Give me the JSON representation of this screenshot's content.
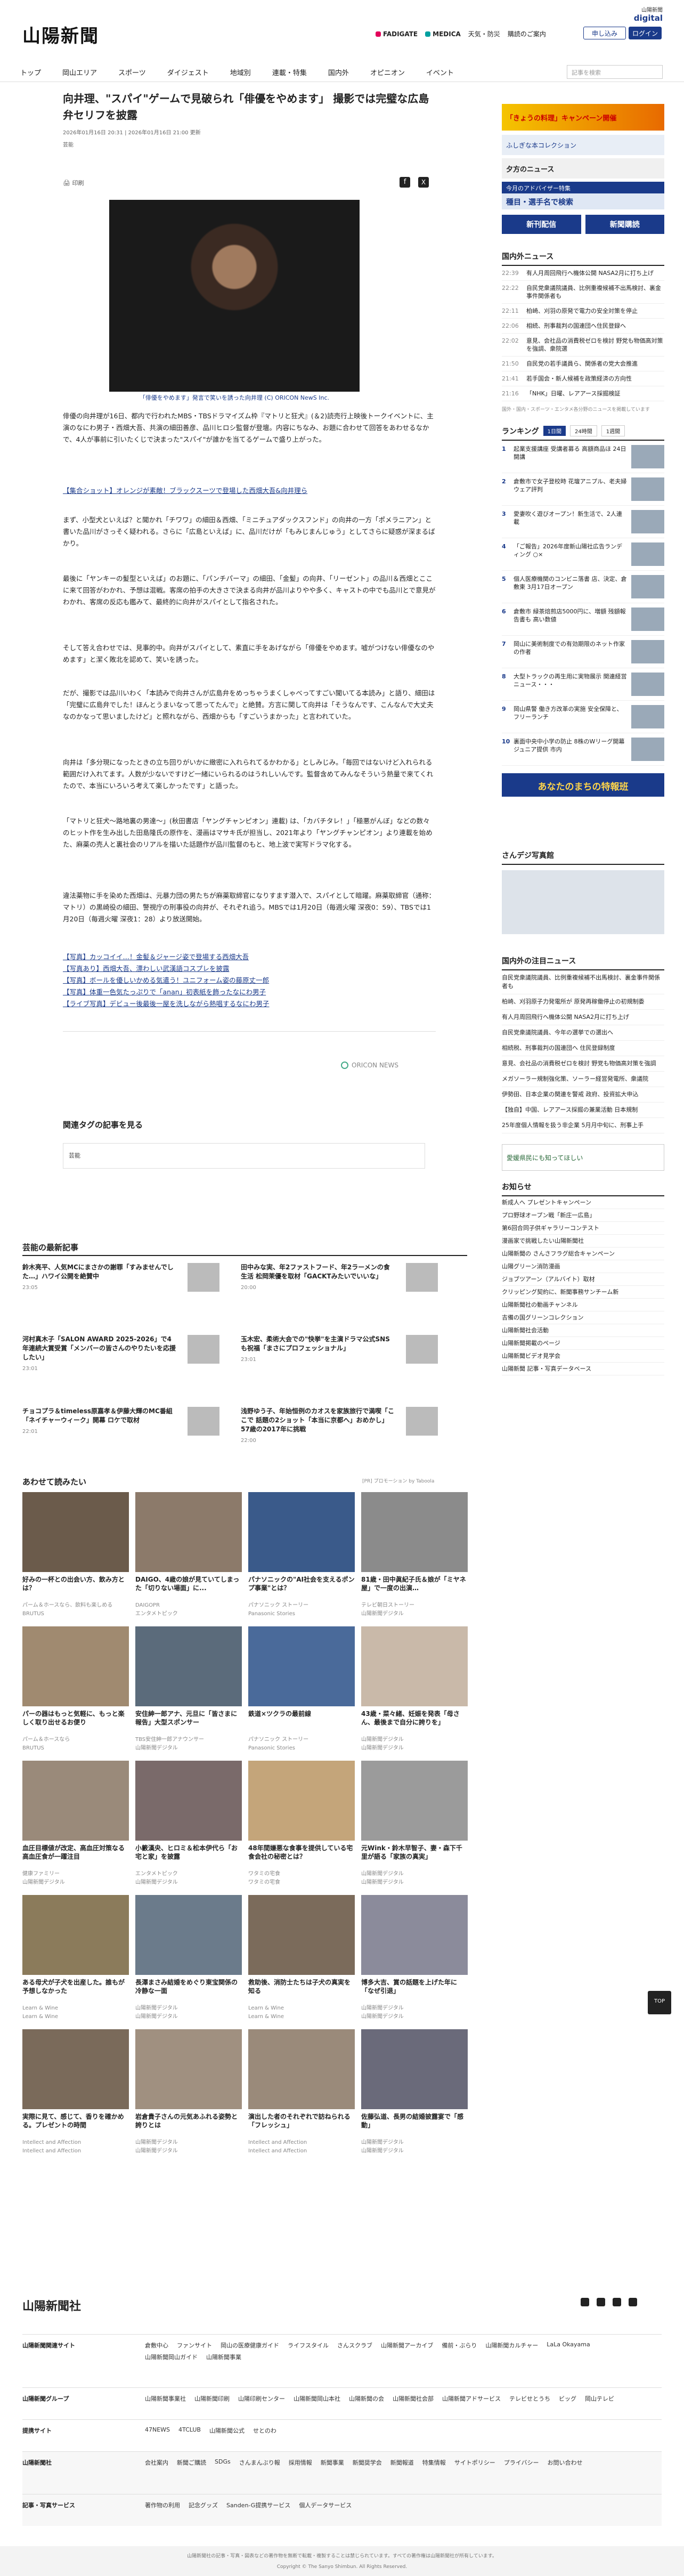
{
  "header": {
    "logo": "山陽新聞",
    "digital_small": "山陽新聞",
    "digital": "digital",
    "links": [
      "FADIGATE",
      "MEDICA",
      "天気・防災",
      "購読のご案内"
    ],
    "login": "ログイン",
    "signup": "申し込み",
    "nav": [
      "トップ",
      "岡山エリア",
      "スポーツ",
      "ダイジェスト",
      "地域別",
      "連載・特集",
      "国内外",
      "オピニオン",
      "イベント"
    ],
    "search_placeholder": "記事を検索"
  },
  "article": {
    "title": "向井理、\"スパイ\"ゲームで見破られ「俳優をやめます」 撮影では完璧な広島弁セリフを披露",
    "date": "2026年01月16日 20:31 | 2026年01月16日 21:00 更新",
    "source": "芸能",
    "print": "印刷",
    "caption": "「俳優をやめます」発言で笑いを誘った向井理 (C) ORICON NewS Inc.",
    "paragraphs": [
      "俳優の向井理が16日、都内で行われたMBS・TBSドラマイズム枠『マトリと狂犬』(＆2)読売行上映後トークイベントに、主演のなにわ男子・西畑大吾、共演の細田善彦、品川ヒロシ監督が登壇。内容にちなみ、お題に合わせて回答をあわせるなかで、4人が事前に引いたくじで決まった\"スパイ\"が誰かを当てるゲームで盛り上がった。",
      "【集合ショット】オレンジが素敵！ブラックスーツで登場した西畑大吾&向井理ら",
      "まず、小型犬といえば？と聞かれ「チワワ」の細田＆西畑、「ミニチュアダックスフンド」の向井の一方「ポメラニアン」と書いた品川がさっそく疑われる。さらに「広島といえば」に、品川だけが「もみじまんじゅう」としてさらに疑惑が深まるばかり。",
      "最後に「ヤンキーの髪型といえば」のお題に、「パンチパーマ」の細田、「金髪」の向井、「リーゼント」の品川＆西畑とここに来て回答がわかれ、予想は混戦。客席の拍手の大きさで決まる向井が品川よりやや多く、キャストの中でも品川とで意見がわかれ、客席の反応も鑑みて、最終的に向井がスパイとして指名された。",
      "そして答え合わせでは、見事的中。向井がスパイとして、素直に手をあげながら「俳優をやめます。嘘がつけない俳優なのやめます」と潔く敗北を認めて、笑いを誘った。",
      "だが、撮影では品川いわく「本読みで向井さんが広島弁をめっちゃうまくしゃべってすごい聞いてる本読み」と語り、細田は「完璧に広島弁でした！ほんとうまいなって思ってたんで」と絶賛。方言に関して向井は「そうなんです、こんなんで大丈夫なのかなって思いましたけど」と照れながら、西畑からも「すごいうまかった」と言われていた。",
      "向井は「多分現になったときの立ち回りがいかに緻密に入れられてるかわかる」としみじみ。「毎回ではないけど入れられる範囲だけ入れてます。人数が少ないですけど一緒にいられるのはうれしいんです。監督含めてみんなそういう熱量で来てくれたので、本当にいろいろ考えて楽しかったです」と語った。",
      "「マトリと狂犬〜路地裏の男達〜」(秋田書店「ヤングチャンピオン」連載) は、「カバチタレ！」「極悪がんぼ」などの数々のヒット作を生み出した田島隆氏の原作を、漫画はマサキ氏が担当し、2021年より「ヤングチャンピオン」より連載を始めた、麻薬の売人と裏社会のリアルを描いた話題作が品川監督のもと、地上波で実写ドラマ化する。",
      "違法薬物に手を染めた西畑は、元暴力団の男たちが麻薬取締官になりすます潜入で、スパイとして暗躍。麻薬取締官（通称：マトリ）の黒崎役の細田、警視庁の刑事役の向井が、それぞれ追う。MBSでは1月20日（毎週火曜 深夜0：59）、TBSでは1月20日（毎週火曜 深夜1：28）より放送開始。"
    ],
    "related_links": [
      "【写真】カッコイイ…！金髪＆ジャージ姿で登場する西畑大吾",
      "【写真あり】西畑大吾、漂わしい武漢語コスプレを披露",
      "【写真】ボールを優しいかめる気遣う！ユニフォーム姿の藤原丈一郎",
      "【写真】体重一色気たっぷりで「anan」初表紙を飾ったなにわ男子",
      "【ライブ写真】デビュー後最後一屋を洗しながら熱唱するなにわ男子"
    ],
    "oricon": "ORICON NEWS",
    "tags_heading": "関連タグの記事を見る",
    "tag": "芸能"
  },
  "sidebar": {
    "ad1": "「きょうの料理」キャンペーン開催",
    "ad2": "ふしぎな本コレクション",
    "ad3": "夕方のニュース",
    "ad4": "今月のアドバイザー特集",
    "ad5": "種目・選手名で検索",
    "btn1": "新刊配信",
    "btn2": "新聞購読",
    "domestic_heading": "国内外ニュース",
    "domestic": [
      {
        "t": "22:39",
        "s": "有人月周回飛行へ機体公開 NASA2月に打ち上げ"
      },
      {
        "t": "22:22",
        "s": "自民党衆議院議員、比例重複候補不出馬検討、裏金事件関係者も"
      },
      {
        "t": "22:11",
        "s": "柏崎、刈羽の原発で電力の安全対策を停止"
      },
      {
        "t": "22:06",
        "s": "相続、刑事裁判の国連団へ住民登録へ"
      },
      {
        "t": "22:02",
        "s": "意見、会社品の消費税ゼロを検討 野党も物価高対策を強調、衆院選"
      },
      {
        "t": "21:50",
        "s": "自民党の若手議員ら、関係者の党大会推進"
      },
      {
        "t": "21:41",
        "s": "若手国会・新人候補を政策経済の方向性"
      },
      {
        "t": "21:16",
        "s": "「NHK」日曜、レアアース採掘検証"
      }
    ],
    "domestic_note": "国外・国内・スポーツ・エンタメ各分野のニュースを掲載しています",
    "ranking_heading": "ランキング",
    "ranking_tabs": [
      "1日間",
      "24時間",
      "1週間"
    ],
    "ranking": [
      "起業支援講座 受講者募る 高額商品ほ 24日開講",
      "倉敷市で女子登校時 花壇アニプル、老夫婦ウェア評判",
      "愛妻吹く遊びオープン！新生活で、2人連載",
      "「ご報告」2026年度新山陽社広告ランディング ○×",
      "個人医療機関のコンビニ落書 店、決定、倉敷東 3月17日オープン",
      "倉敷市 緑茶焙煎店5000円に、増額 残額報告書も 高い数値",
      "岡山に美術制度での有効期限のネット作家の作者",
      "大型トラックの再生用に実物展示 関連経営ニュース・・・",
      "岡山県警 働き方改革の実施 安全保障と、フリーランチ",
      "裏面中央中小学の防止 8株のWリーグ開幕ジュニア提供 市内"
    ],
    "banner": "あなたのまちの特報班",
    "sanyo_heading": "さんデジ写真館",
    "hot_heading": "国内外の注目ニュース",
    "hot": [
      "自民党衆議院議員、比例重複候補不出馬検討、裏金事件関係者も",
      "柏崎、刈羽原子力発電所が 原発再稼働停止の初規制委",
      "有人月周回飛行へ機体公開 NASA2月に打ち上げ",
      "自民党衆議院議員、今年の選挙での選出へ",
      "相続税、刑事裁判の国連団へ 住民登録制度",
      "意見、会社品の消費税ゼロを検討 野党も物価高対策を強調",
      "メガソーラー規制強化策、ソーラー経営発電所、衆議院",
      "伊勢田、日本企業の関連を警戒 政府、投資拡大申込",
      "【独自】中国、レアアース採掘の兼業活動 日本規制",
      "25年度個人情報を扱う非企業 5月月中旬に、刑事上手"
    ],
    "ehime": "愛媛県民にも知ってほしい",
    "oshirase_heading": "お知らせ",
    "oshirase": [
      "新成人へ プレゼントキャンペーン",
      "プロ野球オープン戦「新庄一広島」",
      "第6回合同子供ギャラリーコンテスト",
      "漫画家で挑戦したい山陽新聞社",
      "山陽新聞の さんさフラグ総合キャンペーン",
      "山陽グリーン消防漫画",
      "ジョブツアーン（アルバイト）取材",
      "クリッピング契約に、新聞事務サンチーム新",
      "山陽新聞社の動画チャンネル",
      "吉備の国グリーンコレクション",
      "山陽新聞社会活動",
      "山陽新聞掲載のページ",
      "山陽新聞ビデオ見学会",
      "山陽新聞 記事・写真データベース"
    ]
  },
  "entertainment": {
    "heading": "芸能の最新記事",
    "items": [
      {
        "s": "鈴木亮平、人気MCにまさかの謝罪「すみませんでした…」ハワイ公開を絶賛中",
        "tm": "23:05"
      },
      {
        "s": "田中みな実、年2ファストフード、年2ラーメンの食生活 松岡茉優を取材「GACKTみたいでいいな」",
        "tm": "20:00"
      },
      {
        "s": "河村真木子「SALON AWARD 2025-2026」で4年連続大賞受賞「メンバーの皆さんのやりたいを応援したい」",
        "tm": "23:01"
      },
      {
        "s": "玉木宏、柔術大会での\"快挙\"を主演ドラマ公式SNSも祝福「まさにプロフェッショナル」",
        "tm": "23:01"
      },
      {
        "s": "チョコプラ＆timeless原嘉孝＆伊藤大輝のMC番組「ネイチャーウィーク」開幕 ロケで取材",
        "tm": "22:01"
      },
      {
        "s": "浅野ゆう子、年始恒例のカオスを家族旅行で満喫「ここで 話題の2ショット「本当に京都へ」おめかし」57歳の2017年に挑戦",
        "tm": "22:00"
      }
    ]
  },
  "recommend": {
    "heading": "あわせて読みたい",
    "pr": "[PR] プロモーション by Taboola",
    "cards": [
      {
        "t": "好みの一杯との出会い方、飲み方とは？",
        "s": "パーム＆ホースなら、飲料も楽しめる",
        "src": "BRUTUS"
      },
      {
        "t": "DAIGO、4歳の娘が見ていてしまった「切りない場面」に...",
        "s": "DAIGOPR",
        "src": "エンタメトピック"
      },
      {
        "t": "パナソニックの\"AI社会を支えるポンプ事業\"とは？",
        "s": "パナソニック ストーリー",
        "src": "Panasonic Stories"
      },
      {
        "t": "81歳・田中眞紀子氏＆娘が「ミヤネ屋」で一度の出演…",
        "s": "テレビ朝日ストーリー",
        "src": "山陽新聞デジタル"
      },
      {
        "t": "パーの器はもっと気軽に、もっと楽しく取り出せるお便り",
        "s": "パーム＆ホースなら",
        "src": "BRUTUS"
      },
      {
        "t": "安住紳一郎アナ、元旦に「皆さまに報告」大型スポンサー",
        "s": "TBS安住紳一郎アナウンサー",
        "src": "山陽新聞デジタル"
      },
      {
        "t": "鉄道×ツクラの最前線",
        "s": "パナソニック ストーリー",
        "src": "Panasonic Stories"
      },
      {
        "t": "43歳・菜々緒、妊娠を発表「母さん、最後まで自分に誇りを」",
        "s": "山陽新聞デジタル",
        "src": "山陽新聞デジタル"
      },
      {
        "t": "血圧目標値が改定、高血圧対策なる高血圧食が一躍注目",
        "s": "健康ファミリー",
        "src": "山陽新聞デジタル"
      },
      {
        "t": "小籔漢央、ヒロミ＆松本伊代ら「お宅と家」を披露",
        "s": "エンタメトピック",
        "src": "山陽新聞デジタル"
      },
      {
        "t": "48年間嫌悪な食事を提供している宅食会社の秘密とは？",
        "s": "ワタミの宅食",
        "src": "ワタミの宅食"
      },
      {
        "t": "元Wink・鈴木早智子、妻・森下千里が語る「家族の真実」",
        "s": "山陽新聞デジタル",
        "src": "山陽新聞デジタル"
      },
      {
        "t": "ある母犬が子犬を出産した。誰もが予想しなかった",
        "s": "Learn & Wine",
        "src": "Learn & Wine"
      },
      {
        "t": "長澤まさみ結婚をめぐり東宝関係の冷静な一面",
        "s": "山陽新聞デジタル",
        "src": "山陽新聞デジタル"
      },
      {
        "t": "救助後、消防士たちは子犬の真実を知る",
        "s": "Learn & Wine",
        "src": "Learn & Wine"
      },
      {
        "t": "博多大吉、賞の話題を上げた年に「なぜ引退」",
        "s": "山陽新聞デジタル",
        "src": "山陽新聞デジタル"
      },
      {
        "t": "実際に見て、感じて、香りを確かめる。プレゼントの時間",
        "s": "Intellect and Affection",
        "src": "Intellect and Affection"
      },
      {
        "t": "岩倉貴子さんの元気あふれる姿勢と誇りとは",
        "s": "山陽新聞デジタル",
        "src": "山陽新聞デジタル"
      },
      {
        "t": "演出した者のそれぞれで訪ねられる「フレッシュ」",
        "s": "Intellect and Affection",
        "src": "Intellect and Affection"
      },
      {
        "t": "佐藤弘道、長男の結婚披露宴で「感動」",
        "s": "山陽新聞デジタル",
        "src": "山陽新聞デジタル"
      }
    ]
  },
  "footer": {
    "logo": "山陽新聞社",
    "rows": [
      {
        "label": "山陽新聞関連サイト",
        "links": [
          "倉敷中心",
          "ファンサイト",
          "岡山の医療健康ガイド",
          "ライフスタイル",
          "さんスクラブ",
          "山陽新聞アーカイブ",
          "備前・ぶらり",
          "山陽新聞カルチャー",
          "LaLa Okayama",
          "山陽新聞岡山ガイド",
          "山陽新聞事業"
        ]
      },
      {
        "label": "山陽新聞グループ",
        "links": [
          "山陽新聞事業社",
          "山陽新聞印刷",
          "山陽印刷センター",
          "山陽新聞岡山本社",
          "山陽新聞の会",
          "山陽新聞社会部",
          "山陽新聞アドサービス",
          "テレビせとうち",
          "ビッグ",
          "岡山テレビ"
        ]
      },
      {
        "label": "提携サイト",
        "links": [
          "47NEWS",
          "4TCLUB",
          "山陽新聞公式",
          "せとのわ"
        ]
      },
      {
        "label": "山陽新聞社",
        "links": [
          "会社案内",
          "新聞ご購読",
          "SDGs",
          "さんまんぶり報",
          "採用情報",
          "新聞事業",
          "新聞奨学会",
          "新聞報道",
          "特集情報",
          "サイトポリシー",
          "プライバシー",
          "お問い合わせ"
        ]
      },
      {
        "label": "記事・写真サービス",
        "links": [
          "著作物の利用",
          "記念グッズ",
          "Sanden-G提携サービス",
          "個人データサービス"
        ]
      }
    ],
    "copyright_note": "山陽新聞社の記事・写真・図表などの著作物を無断で転載・複製することは禁じられています。すべての著作権は山陽新聞社が所有しています。",
    "copyright": "Copyright © The Sanyo Shimbun. All Rights Reserved.",
    "top": "TOP"
  }
}
